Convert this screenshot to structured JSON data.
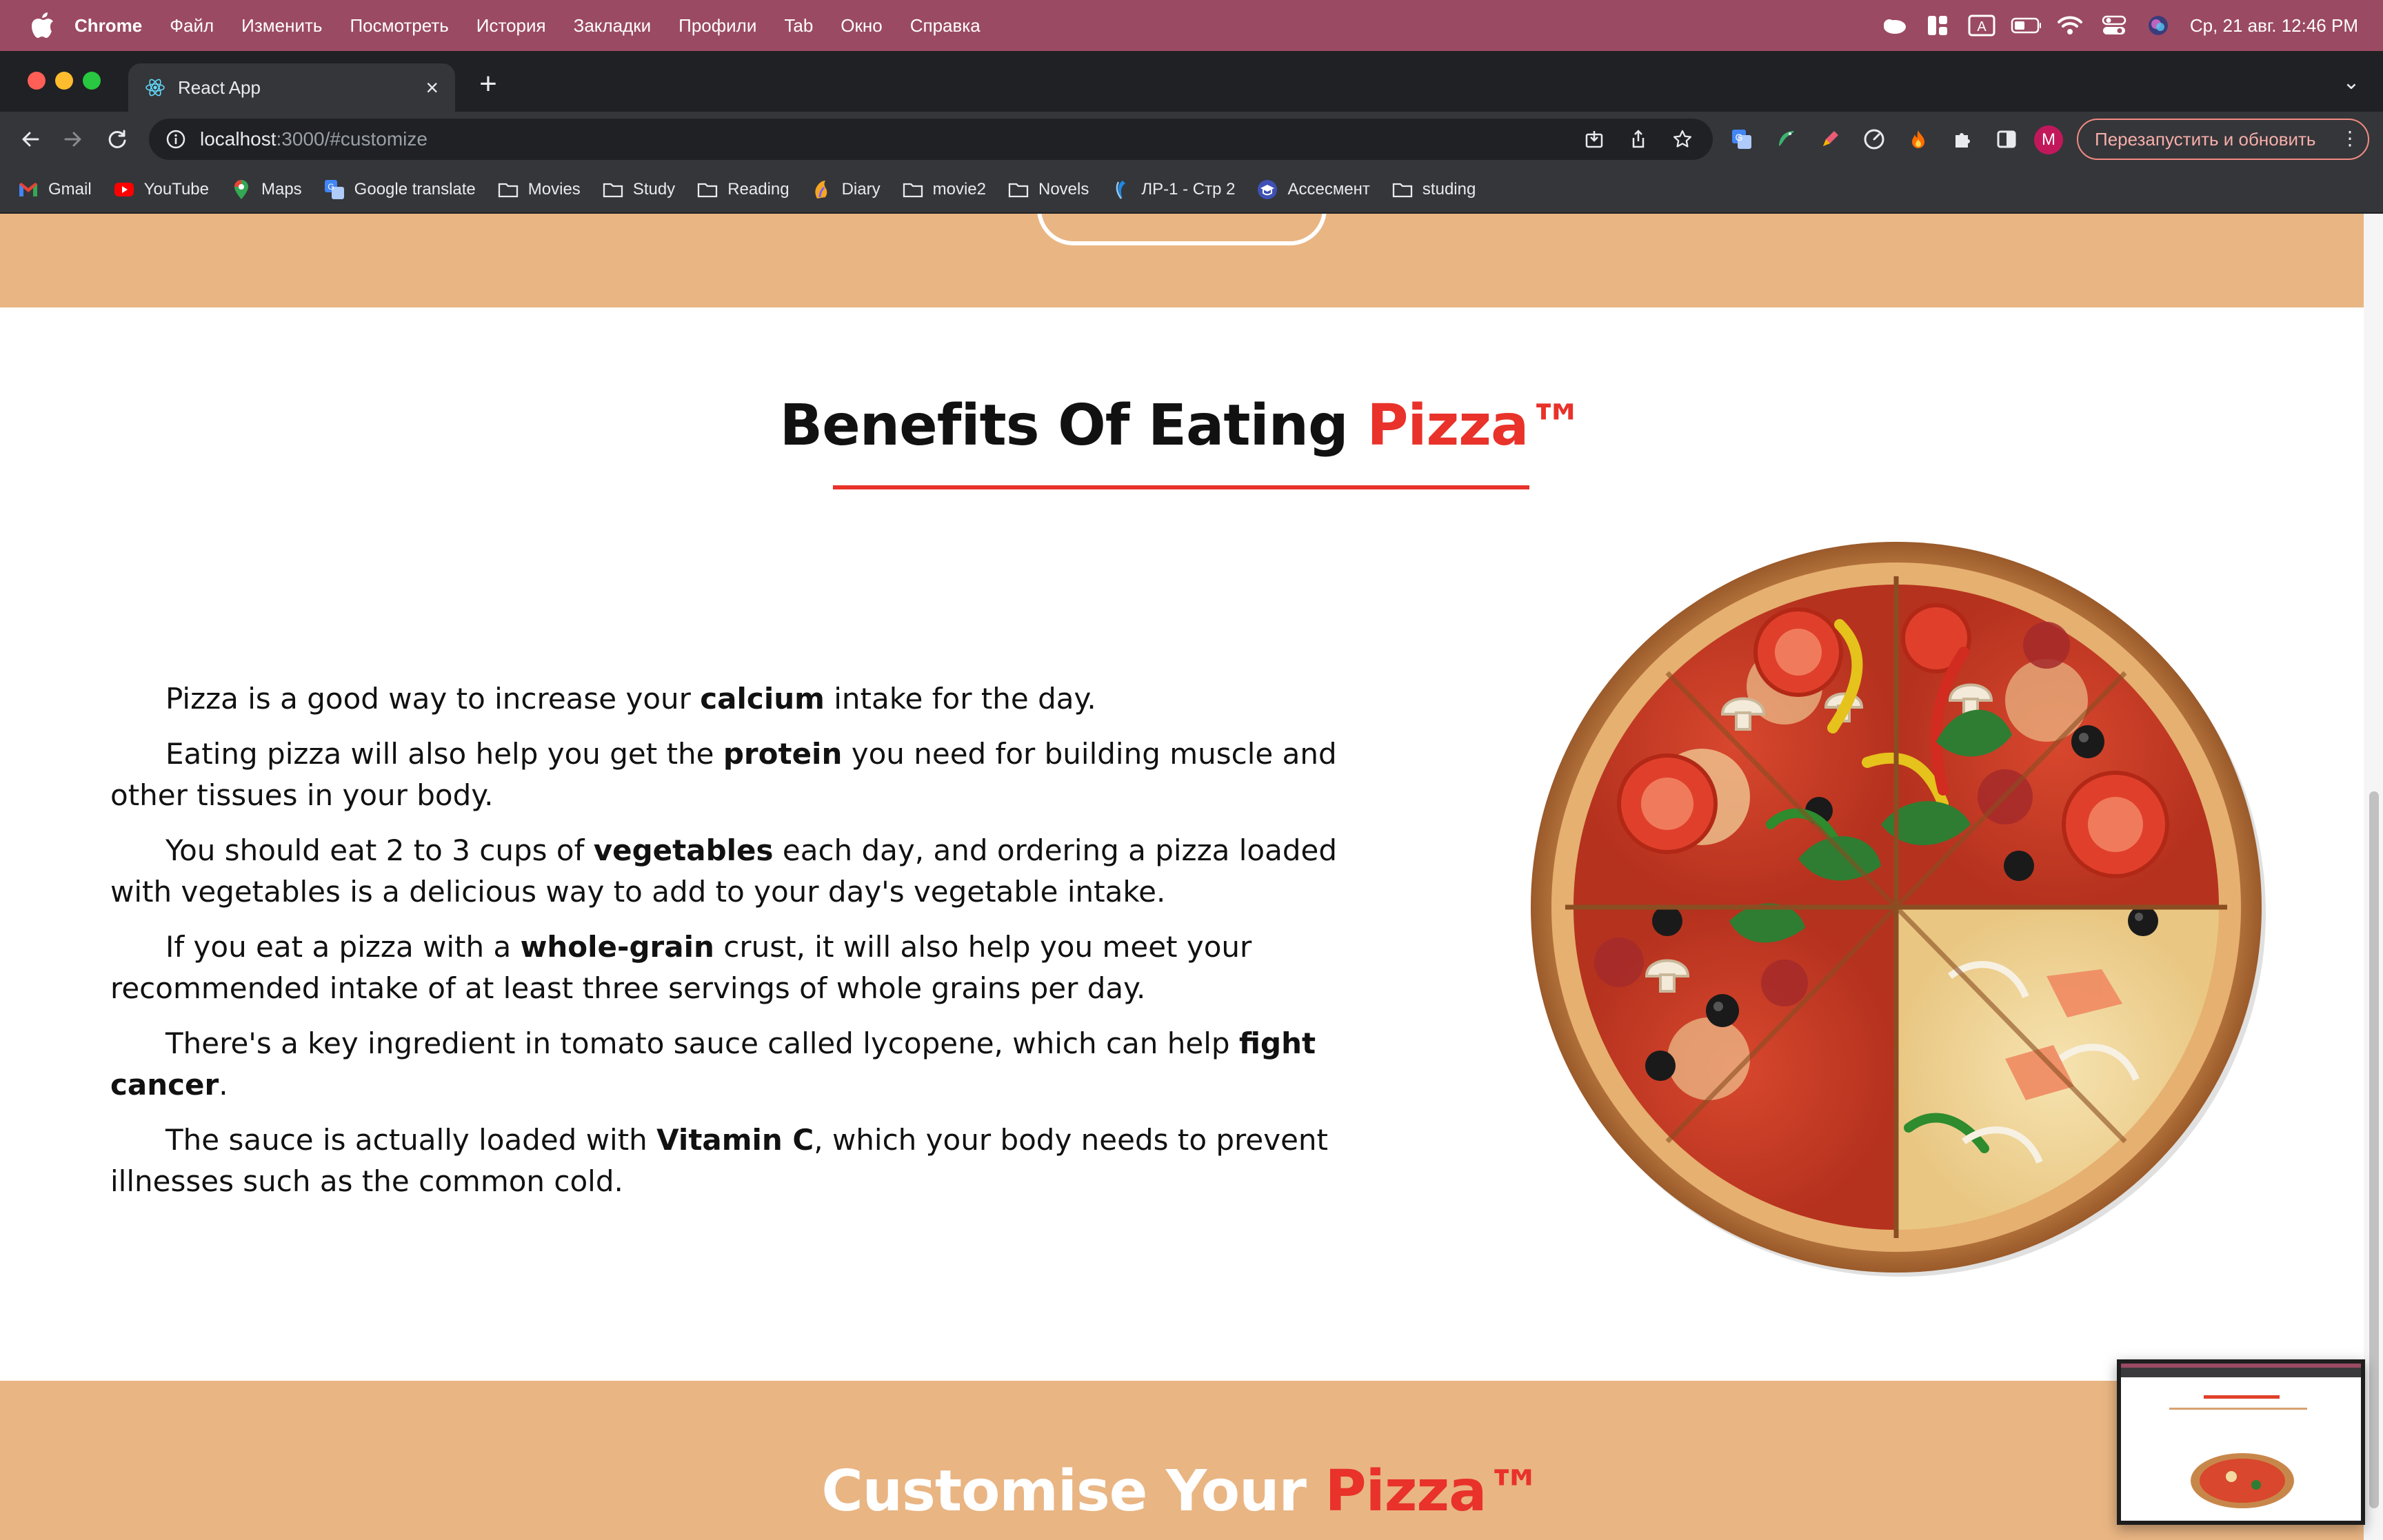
{
  "menubar": {
    "app": "Chrome",
    "items": [
      "Файл",
      "Изменить",
      "Посмотреть",
      "История",
      "Закладки",
      "Профили",
      "Tab",
      "Окно",
      "Справка"
    ],
    "clock": "Ср, 21 авг.  12:46 PM"
  },
  "browser": {
    "tab_title": "React App",
    "url_host": "localhost",
    "url_path": ":3000/#customize",
    "profile_initial": "M",
    "relaunch_label": "Перезапустить и обновить",
    "bookmarks": [
      "Gmail",
      "YouTube",
      "Maps",
      "Google translate",
      "Movies",
      "Study",
      "Reading",
      "Diary",
      "movie2",
      "Novels",
      "ЛР-1 - Стр 2",
      "Ассесмент",
      "studing"
    ]
  },
  "benefits": {
    "title_main": "Benefits Of Eating",
    "title_accent": "Pizza™",
    "p1": {
      "pre": "Pizza is a good way to increase your ",
      "bold": "calcium",
      "post": " intake for the day."
    },
    "p2": {
      "pre": "Eating pizza will also help you get the ",
      "bold": "protein",
      "post": " you need for building muscle and other tissues in your body."
    },
    "p3": {
      "pre": "You should eat 2 to 3 cups of ",
      "bold": "vegetables",
      "post": " each day, and ordering a pizza loaded with vegetables is a delicious way to add to your day's vegetable intake."
    },
    "p4": {
      "pre": "If you eat a pizza with a ",
      "bold": "whole-grain",
      "post": " crust, it will also help you meet your recommended intake of at least three servings of whole grains per day."
    },
    "p5": {
      "pre": "There's a key ingredient in tomato sauce called lycopene, which can help ",
      "bold": "fight cancer",
      "post": "."
    },
    "p6": {
      "pre": "The sauce is actually loaded with ",
      "bold": "Vitamin C",
      "post": ", which your body needs to prevent illnesses such as the common cold."
    }
  },
  "customise": {
    "title_main": "Customise Your",
    "title_accent": "Pizza™"
  },
  "colors": {
    "accent": "#e8322a",
    "band": "#e9b583",
    "menubar": "#9b4a63"
  }
}
